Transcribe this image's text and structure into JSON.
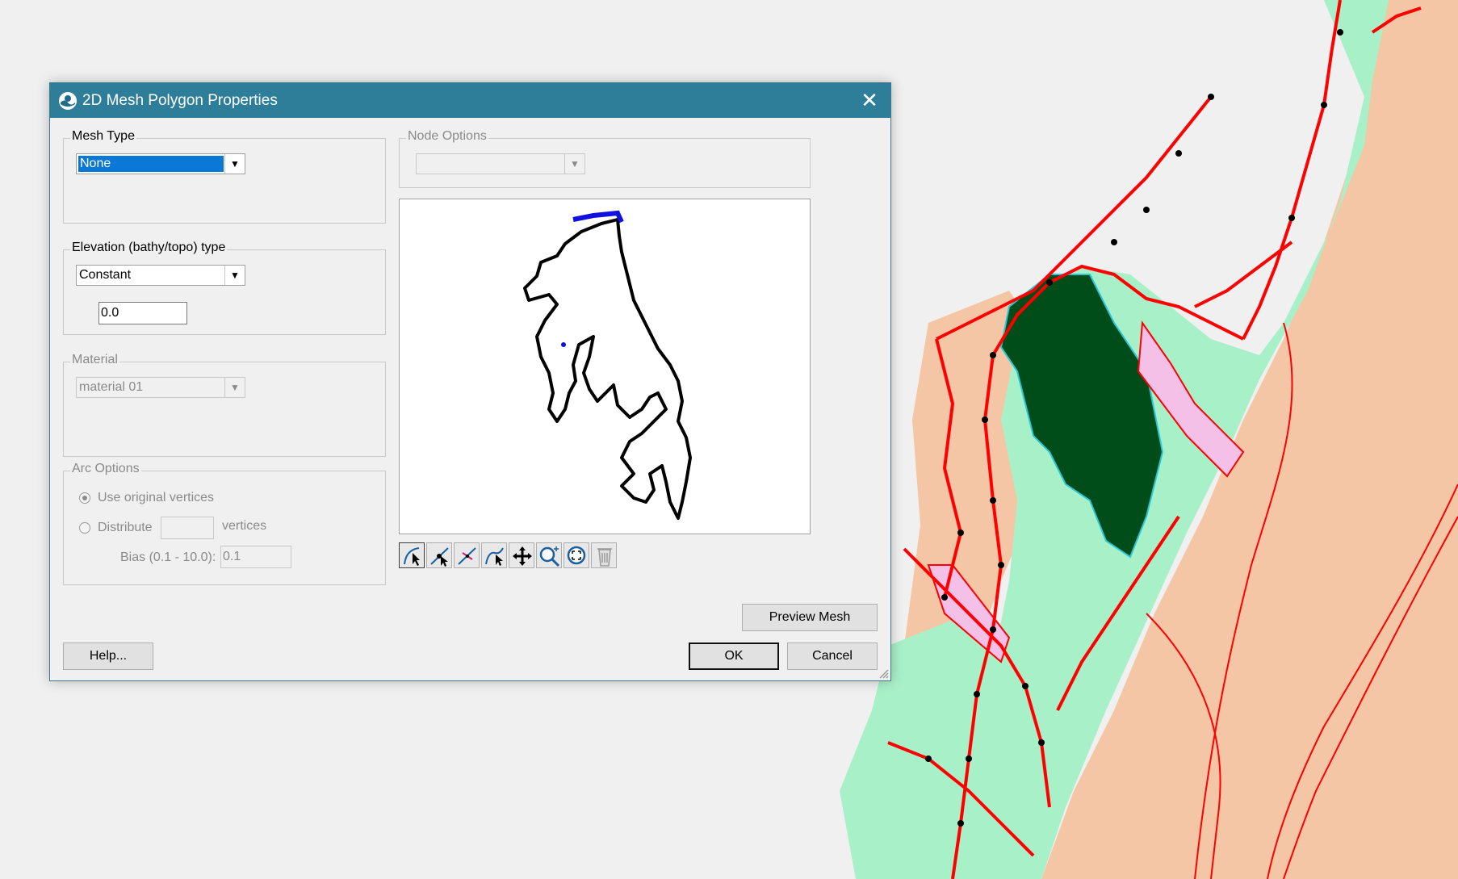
{
  "dialog": {
    "title": "2D Mesh Polygon Properties",
    "close_glyph": "✕"
  },
  "mesh_type": {
    "label": "Mesh Type",
    "value": "None"
  },
  "elevation": {
    "label": "Elevation (bathy/topo) type",
    "value": "Constant",
    "constant_value": "0.0"
  },
  "material": {
    "label": "Material",
    "value": "material 01"
  },
  "arc_options": {
    "label": "Arc Options",
    "use_original": "Use original vertices",
    "distribute": "Distribute",
    "vertices_suffix": "vertices",
    "bias_label": "Bias (0.1 - 10.0):",
    "bias_value": "0.1"
  },
  "node_options": {
    "label": "Node Options",
    "value": ""
  },
  "toolbar": {
    "tools": [
      "select-arc-icon",
      "select-vertex-icon",
      "split-arc-icon",
      "redistribute-icon",
      "pan-icon",
      "zoom-icon",
      "frame-icon",
      "delete-icon"
    ]
  },
  "buttons": {
    "preview_mesh": "Preview Mesh",
    "help": "Help...",
    "ok": "OK",
    "cancel": "Cancel"
  },
  "colors": {
    "titlebar": "#2e7d99",
    "land": "#f5c6a5",
    "water": "#a8f0c8",
    "arc_red": "#ff0000",
    "forest": "#004d1a",
    "selection": "#0a78d7"
  }
}
